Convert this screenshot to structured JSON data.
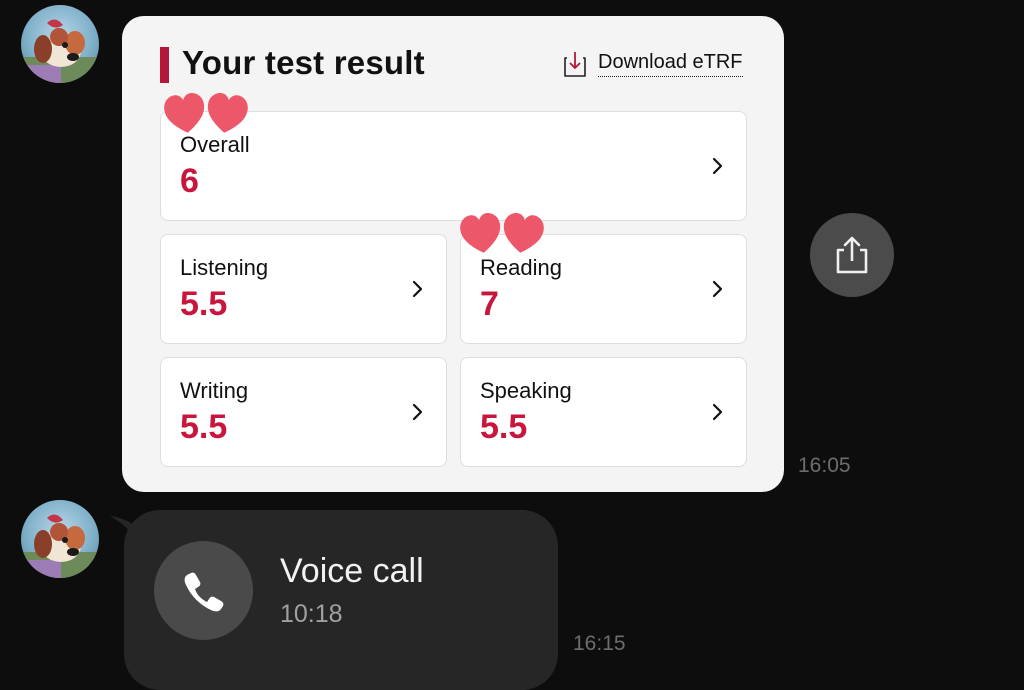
{
  "chat": {
    "messages": [
      {
        "type": "test-result",
        "title": "Your test result",
        "download_label": "Download eTRF",
        "scores": {
          "overall": {
            "label": "Overall",
            "value": "6"
          },
          "listening": {
            "label": "Listening",
            "value": "5.5"
          },
          "reading": {
            "label": "Reading",
            "value": "7"
          },
          "writing": {
            "label": "Writing",
            "value": "5.5"
          },
          "speaking": {
            "label": "Speaking",
            "value": "5.5"
          }
        },
        "time": "16:05"
      },
      {
        "type": "voice-call",
        "title": "Voice call",
        "duration": "10:18",
        "time": "16:15"
      }
    ]
  },
  "icons": {
    "download": "download-icon",
    "chevron": "chevron-right-icon",
    "share": "share-icon",
    "phone": "phone-icon",
    "heart": "heart-icon"
  },
  "colors": {
    "background": "#0d0d0d",
    "card": "#f4f4f4",
    "accent": "#c8163c",
    "accent_bar": "#b3173a",
    "heart": "#ec5769",
    "call_bubble": "#262626",
    "share_button": "#4b4b4b",
    "timestamp": "#6d6d6d"
  }
}
